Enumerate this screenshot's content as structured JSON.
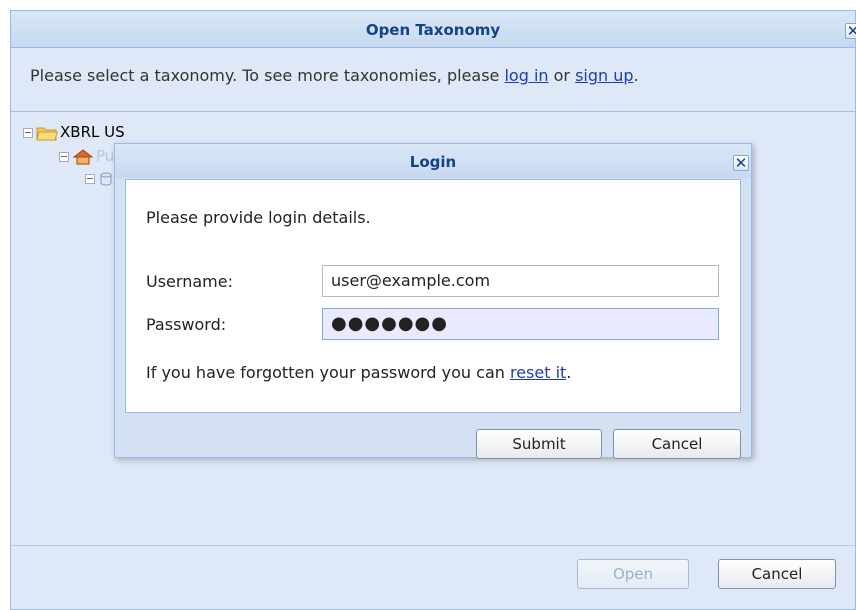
{
  "outer": {
    "title": "Open Taxonomy",
    "message_prefix": "Please select a taxonomy. To see more taxonomies, please ",
    "login_link": "log in",
    "message_or": " or ",
    "signup_link": "sign up",
    "message_suffix": ".",
    "tree": [
      {
        "label": "XBRL US",
        "icon": "folder-open-icon"
      },
      {
        "label": "Public Review",
        "icon": "house-icon"
      },
      {
        "label": "",
        "icon": "db-icon"
      }
    ],
    "buttons": {
      "open": "Open",
      "cancel": "Cancel"
    }
  },
  "login": {
    "title": "Login",
    "message": "Please provide login details.",
    "username_label": "Username:",
    "username_value": "user@example.com",
    "password_label": "Password:",
    "password_value": "●●●●●●●",
    "forgot_prefix": "If you have forgotten your password you can ",
    "reset_link": "reset it",
    "forgot_suffix": ".",
    "submit": "Submit",
    "cancel": "Cancel"
  },
  "icons": {
    "close": "close-icon"
  },
  "colors": {
    "title_text": "#15428b",
    "panel_bg": "#dfe8f6",
    "link": "#1a3fb5"
  }
}
